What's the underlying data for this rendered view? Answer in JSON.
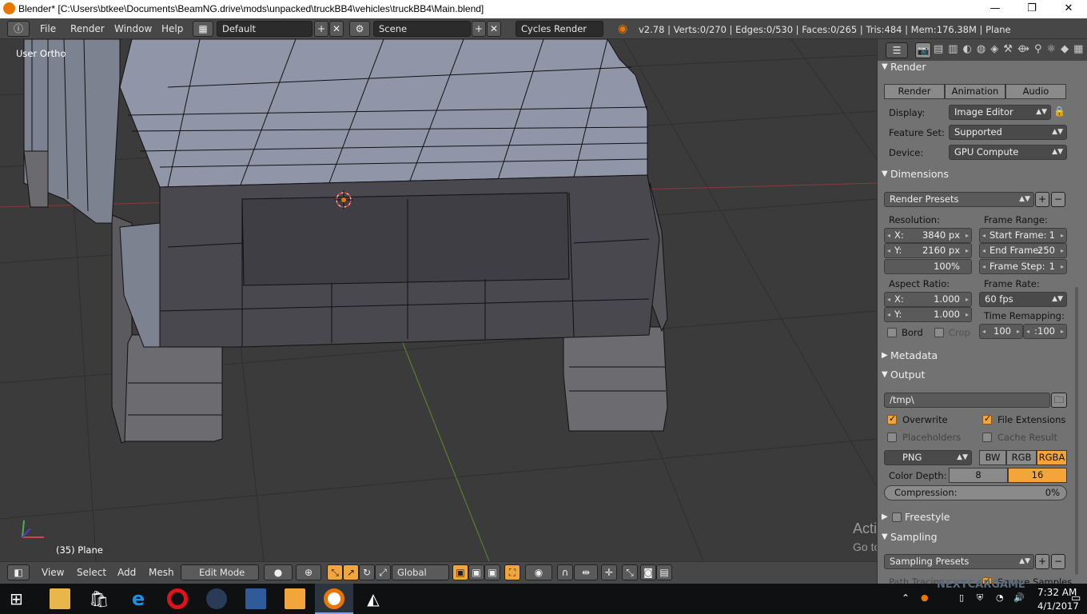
{
  "window": {
    "title": "Blender* [C:\\Users\\btkee\\Documents\\BeamNG.drive\\mods\\unpacked\\truckBB4\\vehicles\\truckBB4\\Main.blend]",
    "minimize": "—",
    "maximize": "❐",
    "close": "✕"
  },
  "topbar": {
    "menus": [
      "File",
      "Render",
      "Window",
      "Help"
    ],
    "layout": "Default",
    "scene": "Scene",
    "engine": "Cycles Render",
    "stats": "v2.78 | Verts:0/270 | Edges:0/530 | Faces:0/265 | Tris:484 | Mem:176.38M | Plane"
  },
  "viewport": {
    "view_label": "User Ortho",
    "object_label": "(35) Plane",
    "watermark_line1": "Activate Windows",
    "watermark_line2": "Go to Settings to activate Windows.",
    "colors": {
      "background": "#3b3b3b",
      "grid": "#2e2e2e",
      "x_axis": "#8b3a3a",
      "y_axis": "#5f8a2e",
      "mesh_light": "#8a8f9e",
      "mesh_dark": "#3d3d42"
    }
  },
  "view3d_header": {
    "menus": [
      "View",
      "Select",
      "Add",
      "Mesh"
    ],
    "mode": "Edit Mode",
    "orientation": "Global"
  },
  "properties": {
    "render_panel": {
      "title": "Render",
      "buttons": [
        "Render",
        "Animation",
        "Audio"
      ],
      "display_label": "Display:",
      "display_value": "Image Editor",
      "feature_set_label": "Feature Set:",
      "feature_set_value": "Supported",
      "device_label": "Device:",
      "device_value": "GPU Compute"
    },
    "dimensions_panel": {
      "title": "Dimensions",
      "presets": "Render Presets",
      "resolution_label": "Resolution:",
      "res_x_label": "X:",
      "res_x": "3840 px",
      "res_y_label": "Y:",
      "res_y": "2160 px",
      "res_pct": "100%",
      "frame_range_label": "Frame Range:",
      "start_label": "Start Frame:",
      "start": "1",
      "end_label": "End Frame:",
      "end": "250",
      "step_label": "Frame Step:",
      "step": "1",
      "aspect_label": "Aspect Ratio:",
      "aspect_x_label": "X:",
      "aspect_x": "1.000",
      "aspect_y_label": "Y:",
      "aspect_y": "1.000",
      "frame_rate_label": "Frame Rate:",
      "frame_rate": "60 fps",
      "time_remap_label": "Time Remapping:",
      "remap_old": "100",
      "remap_new": ":100",
      "bord": "Bord",
      "crop": "Crop"
    },
    "metadata_title": "Metadata",
    "output_panel": {
      "title": "Output",
      "path": "/tmp\\",
      "overwrite": "Overwrite",
      "file_extensions": "File Extensions",
      "placeholders": "Placeholders",
      "cache_result": "Cache Result",
      "format": "PNG",
      "bw": "BW",
      "rgb": "RGB",
      "rgba": "RGBA",
      "color_depth_label": "Color Depth:",
      "depth_8": "8",
      "depth_16": "16",
      "compression_label": "Compression:",
      "compression_value": "0%"
    },
    "freestyle_title": "Freestyle",
    "sampling_title": "Sampling",
    "sampling_presets": "Sampling Presets",
    "path_tracing": "Path Tracing",
    "square_samples": "Square Samples"
  },
  "taskbar": {
    "time": "7:32 AM",
    "date": "4/1/2017",
    "tray_text": "NEXTCARGAME"
  }
}
